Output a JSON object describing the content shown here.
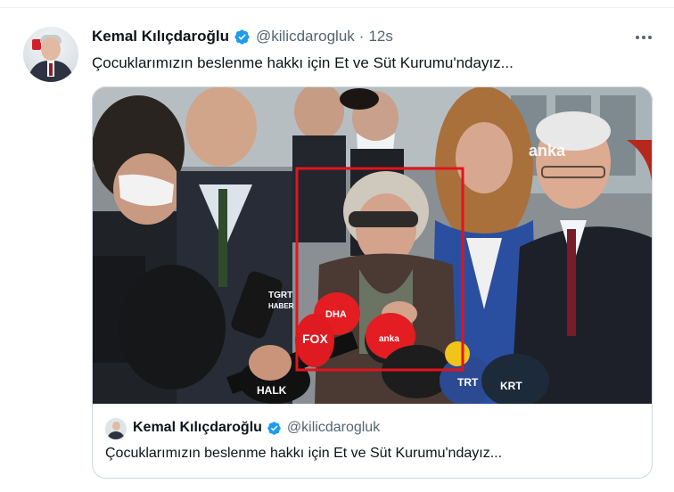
{
  "tweet": {
    "author_name": "Kemal Kılıçdaroğlu",
    "handle": "@kilicdarogluk",
    "separator": "·",
    "time": "12s",
    "text": "Çocuklarımızın beslenme hakkı için Et ve Süt Kurumu'ndayız...",
    "verified_icon": "verified-badge-icon",
    "more_icon": "more-options-icon"
  },
  "media": {
    "watermark": "anka",
    "mic_labels": [
      "TGRT HABER",
      "DHA",
      "FOX",
      "anka",
      "TRT",
      "KRT",
      "HALK"
    ],
    "highlight_color": "#e3141b"
  },
  "quote": {
    "author_name": "Kemal Kılıçdaroğlu",
    "handle": "@kilicdarogluk",
    "text": "Çocuklarımızın beslenme hakkı için Et ve Süt Kurumu'ndayız..."
  },
  "colors": {
    "text": "#0f1419",
    "secondary": "#536471",
    "verified": "#1d9bf0",
    "border": "#cfd9de"
  }
}
